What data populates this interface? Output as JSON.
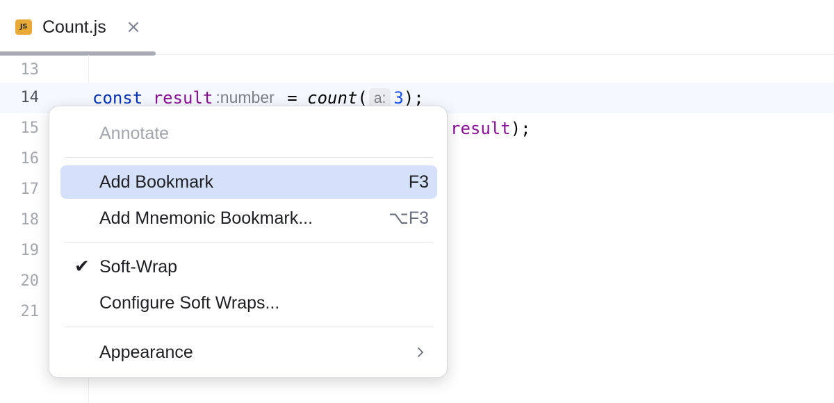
{
  "tab": {
    "icon_label": "JS",
    "title": "Count.js",
    "close_glyph": "×",
    "icon": "close-icon"
  },
  "editor": {
    "lines": [
      {
        "number": "13"
      },
      {
        "number": "14"
      },
      {
        "number": "15"
      },
      {
        "number": "16"
      },
      {
        "number": "17"
      },
      {
        "number": "18"
      },
      {
        "number": "19"
      },
      {
        "number": "20"
      },
      {
        "number": "21"
      }
    ],
    "line14": {
      "kw": "const",
      "var": "result",
      "type_hint": ":number",
      "assign": " = ",
      "fn": "count",
      "open": "(",
      "param_hint": "a:",
      "arg": "3",
      "close": ");"
    },
    "line15": {
      "var": "result",
      "close": ");"
    }
  },
  "menu": {
    "annotate": "Annotate",
    "add_bookmark": "Add Bookmark",
    "add_bookmark_shortcut": "F3",
    "add_mnemonic": "Add Mnemonic Bookmark...",
    "add_mnemonic_shortcut": "⌥F3",
    "soft_wrap": "Soft-Wrap",
    "soft_wrap_check": "✔",
    "configure_soft_wraps": "Configure Soft Wraps...",
    "appearance": "Appearance"
  },
  "colors": {
    "keyword": "#0033b3",
    "variable": "#871094",
    "number": "#1750eb",
    "selection": "#d5e1fb",
    "current_line": "#f5f8fe",
    "js_icon": "#e8a937"
  }
}
